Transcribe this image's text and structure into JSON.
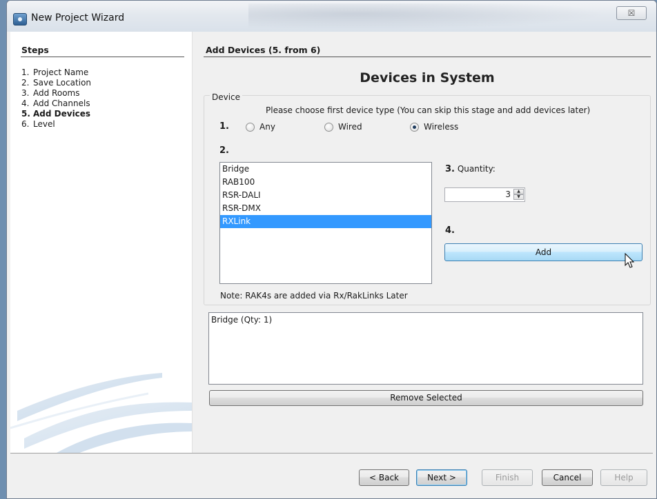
{
  "window": {
    "title": "New Project Wizard",
    "close_glyph": "☒"
  },
  "steps": {
    "title": "Steps",
    "items": [
      {
        "num": "1.",
        "label": "Project Name"
      },
      {
        "num": "2.",
        "label": "Save Location"
      },
      {
        "num": "3.",
        "label": "Add Rooms"
      },
      {
        "num": "4.",
        "label": "Add Channels"
      },
      {
        "num": "5.",
        "label": "Add Devices",
        "active": true
      },
      {
        "num": "6.",
        "label": "Level"
      }
    ]
  },
  "main": {
    "title": "Add Devices (5. from 6)",
    "heading": "Devices in System",
    "group_label": "Device",
    "instructions": "Please choose first device type (You can skip this stage and add devices later)",
    "step1": "1.",
    "step2": "2.",
    "step3": "3.",
    "step4": "4.",
    "device_types": [
      {
        "label": "Any",
        "checked": false
      },
      {
        "label": "Wired",
        "checked": false
      },
      {
        "label": "Wireless",
        "checked": true
      }
    ],
    "devices": [
      "Bridge",
      "RAB100",
      "RSR-DALI",
      "RSR-DMX",
      "RXLink"
    ],
    "selected_device": "RXLink",
    "quantity_label": "Quantity:",
    "quantity": "3",
    "add_label": "Add",
    "note": "Note: RAK4s are added via Rx/RakLinks Later",
    "added": [
      "Bridge (Qty: 1)"
    ],
    "remove_label": "Remove Selected"
  },
  "footer": {
    "back": "< Back",
    "next": "Next >",
    "finish": "Finish",
    "cancel": "Cancel",
    "help": "Help"
  },
  "icons": {
    "app": "app-icon",
    "cursor": "pointer-cursor-icon"
  }
}
